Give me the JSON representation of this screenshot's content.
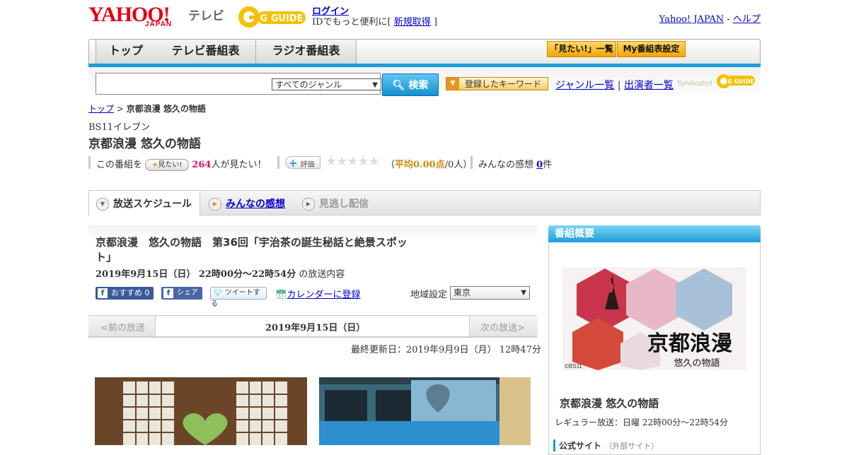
{
  "header": {
    "logo_text": "YAHOO!",
    "logo_sub": "JAPAN",
    "service_name": "テレビ",
    "gguide_text": "G GUIDE",
    "login_label": "ログイン",
    "login_sub_prefix": "IDでもっと便利に[",
    "register_label": "新規取得",
    "login_sub_suffix": "]",
    "yahoo_japan_link": "Yahoo! JAPAN",
    "separator": "-",
    "help_link": "ヘルプ"
  },
  "nav": {
    "tabs": [
      "トップ",
      "テレビ番組表",
      "ラジオ番組表"
    ],
    "mitai_list": "「見たい!」一覧",
    "my_schedule": "My番組表設定"
  },
  "search": {
    "genre_selected": "すべてのジャンル",
    "search_button": "検索",
    "keyword_button": "登録したキーワード",
    "genre_list": "ジャンル一覧",
    "link_sep": "|",
    "cast_list": "出演者一覧",
    "syndicated": "Syndicated"
  },
  "breadcrumb": {
    "home": "トップ",
    "sep": ">",
    "current": "京都浪漫 悠久の物語"
  },
  "program": {
    "channel": "BS11イレブン",
    "title": "京都浪漫 悠久の物語",
    "want_prefix": "この番組を",
    "want_button": "見たい!",
    "want_count": "264",
    "want_suffix": "人が見たい！",
    "rating_label": "評価",
    "stars": "★★★★★",
    "avg_open": "（",
    "avg_value": "平均0.00点",
    "avg_count": "/0人）",
    "impressions_label": "みんなの感想",
    "impressions_count": "0",
    "impressions_unit": "件"
  },
  "tabs": {
    "schedule": "放送スケジュール",
    "impressions": "みんなの感想",
    "missed": "見逃し配信"
  },
  "episode": {
    "title": "京都浪漫　悠久の物語　第36回「宇治茶の誕生秘話と絶景スポット」",
    "datetime": "2019年9月15日（日）  22時00分～22時54分",
    "datetime_suffix": "の放送内容",
    "fb_recommend": "おすすめ 0",
    "fb_share": "シェア",
    "tweet": "ツイートする",
    "calendar": "カレンダーに登録",
    "region_label": "地域設定",
    "region_value": "東京",
    "prev": "<前の放送",
    "date": "2019年9月15日（日）",
    "next": "次の放送>",
    "updated": "最終更新日：2019年9月9日（月）  12時47分"
  },
  "sidebar": {
    "header": "番組概要",
    "image_caption": "京都浪漫",
    "image_sub": "悠久の物語",
    "copyright": "©BS11",
    "title": "京都浪漫 悠久の物語",
    "regular": "レギュラー放送：日曜 22時00分～22時54分",
    "official_site": "公式サイト",
    "external": "（外部サイト）"
  },
  "colors": {
    "accent_blue": "#1a9ed9",
    "yahoo_red": "#e60012",
    "want_pink": "#d4145a",
    "avg_orange": "#d18a00"
  }
}
